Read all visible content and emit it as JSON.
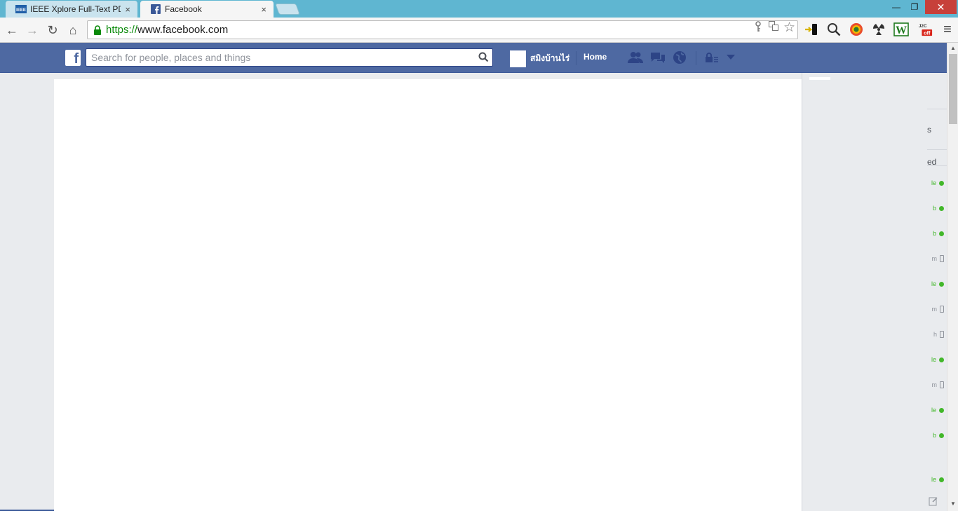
{
  "browser": {
    "tabs": [
      {
        "title": "IEEE Xplore Full-Text PDF:",
        "favicon": "ieee-icon",
        "active": false
      },
      {
        "title": "Facebook",
        "favicon": "facebook-icon",
        "active": true
      }
    ],
    "close_glyph": "×",
    "window_controls": {
      "minimize": "—",
      "restore": "❐",
      "close": "✕"
    },
    "url_protocol": "https://",
    "url_host": "www.facebook.com",
    "nav_glyphs": {
      "back": "←",
      "forward": "→",
      "reload": "↻",
      "home": "⌂",
      "star": "☆",
      "menu": "≡"
    },
    "extensions": [
      "key-icon",
      "translate-icon",
      "bookmark-star-icon",
      "device-icon",
      "magnifier-icon",
      "chrome-circle-icon",
      "radiation-icon",
      "word-w-icon",
      "j2c-off-icon",
      "menu-icon"
    ],
    "ext_labels": {
      "word": "W",
      "j2c": "J2C",
      "off": "off"
    }
  },
  "facebook": {
    "logo": "f",
    "search_placeholder": "Search for people, places and things",
    "username": "สมิงบ้านไร่",
    "home_label": "Home",
    "accent": "#4e69a2",
    "online_color": "#42b72a"
  },
  "chat": {
    "header_frags": [
      "s",
      "ed"
    ],
    "rows": [
      {
        "name_tail": "le",
        "status": "web"
      },
      {
        "name_tail": "b",
        "status": "web"
      },
      {
        "name_tail": "b",
        "status": "web"
      },
      {
        "name_tail": "m",
        "status": "mobile"
      },
      {
        "name_tail": "le",
        "status": "web"
      },
      {
        "name_tail": "m",
        "status": "mobile"
      },
      {
        "name_tail": "h",
        "status": "mobile"
      },
      {
        "name_tail": "le",
        "status": "web"
      },
      {
        "name_tail": "m",
        "status": "mobile"
      },
      {
        "name_tail": "le",
        "status": "web"
      },
      {
        "name_tail": "b",
        "status": "web"
      },
      {
        "name_tail": "le",
        "status": "web"
      }
    ]
  }
}
